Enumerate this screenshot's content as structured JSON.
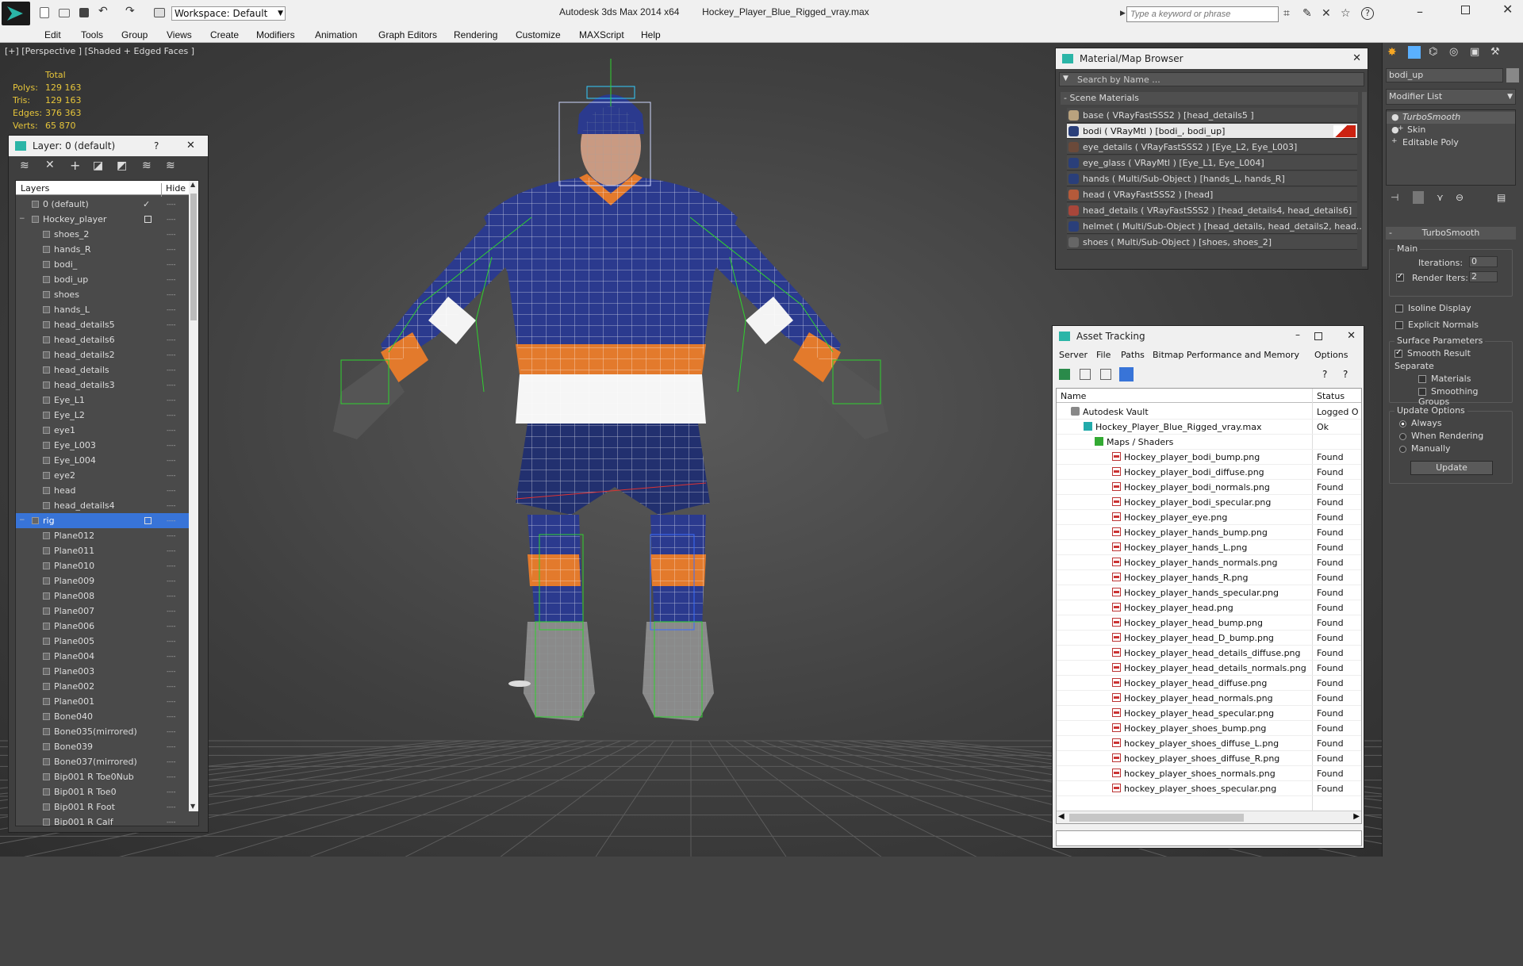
{
  "titlebar": {
    "app": "Autodesk 3ds Max  2014 x64",
    "file": "Hockey_Player_Blue_Rigged_vray.max",
    "workspace": "Workspace: Default",
    "search_placeholder": "Type a keyword or phrase"
  },
  "menu": [
    "Edit",
    "Tools",
    "Group",
    "Views",
    "Create",
    "Modifiers",
    "Animation",
    "Graph Editors",
    "Rendering",
    "Customize",
    "MAXScript",
    "Help"
  ],
  "viewport": {
    "label": "[+] [Perspective ] [Shaded + Edged Faces ]",
    "stats": {
      "header": "Total",
      "rows": [
        {
          "k": "Polys:",
          "v": "129 163"
        },
        {
          "k": "Tris:",
          "v": "129 163"
        },
        {
          "k": "Edges:",
          "v": "376 363"
        },
        {
          "k": "Verts:",
          "v": "65 870"
        }
      ]
    }
  },
  "layer_panel": {
    "title": "Layer: 0 (default)",
    "help": "?",
    "col_layers": "Layers",
    "col_hide": "Hide",
    "items": [
      {
        "label": "0 (default)",
        "indent": 1
      },
      {
        "label": "Hockey_player",
        "indent": 1
      },
      {
        "label": "shoes_2",
        "indent": 2
      },
      {
        "label": "hands_R",
        "indent": 2
      },
      {
        "label": "bodi_",
        "indent": 2
      },
      {
        "label": "bodi_up",
        "indent": 2
      },
      {
        "label": "shoes",
        "indent": 2
      },
      {
        "label": "hands_L",
        "indent": 2
      },
      {
        "label": "head_details5",
        "indent": 2
      },
      {
        "label": "head_details6",
        "indent": 2
      },
      {
        "label": "head_details2",
        "indent": 2
      },
      {
        "label": "head_details",
        "indent": 2
      },
      {
        "label": "head_details3",
        "indent": 2
      },
      {
        "label": "Eye_L1",
        "indent": 2
      },
      {
        "label": "Eye_L2",
        "indent": 2
      },
      {
        "label": "eye1",
        "indent": 2
      },
      {
        "label": "Eye_L003",
        "indent": 2
      },
      {
        "label": "Eye_L004",
        "indent": 2
      },
      {
        "label": "eye2",
        "indent": 2
      },
      {
        "label": "head",
        "indent": 2
      },
      {
        "label": "head_details4",
        "indent": 2
      },
      {
        "label": "rig",
        "indent": 1,
        "selected": true
      },
      {
        "label": "Plane012",
        "indent": 2
      },
      {
        "label": "Plane011",
        "indent": 2
      },
      {
        "label": "Plane010",
        "indent": 2
      },
      {
        "label": "Plane009",
        "indent": 2
      },
      {
        "label": "Plane008",
        "indent": 2
      },
      {
        "label": "Plane007",
        "indent": 2
      },
      {
        "label": "Plane006",
        "indent": 2
      },
      {
        "label": "Plane005",
        "indent": 2
      },
      {
        "label": "Plane004",
        "indent": 2
      },
      {
        "label": "Plane003",
        "indent": 2
      },
      {
        "label": "Plane002",
        "indent": 2
      },
      {
        "label": "Plane001",
        "indent": 2
      },
      {
        "label": "Bone040",
        "indent": 2
      },
      {
        "label": "Bone035(mirrored)",
        "indent": 2
      },
      {
        "label": "Bone039",
        "indent": 2
      },
      {
        "label": "Bone037(mirrored)",
        "indent": 2
      },
      {
        "label": "Bip001 R Toe0Nub",
        "indent": 2
      },
      {
        "label": "Bip001 R Toe0",
        "indent": 2
      },
      {
        "label": "Bip001 R Foot",
        "indent": 2
      },
      {
        "label": "Bip001 R Calf",
        "indent": 2
      }
    ]
  },
  "material_browser": {
    "title": "Material/Map Browser",
    "search_placeholder": "Search by Name ...",
    "section": "- Scene Materials",
    "items": [
      "base  ( VRayFastSSS2 )  [head_details5 ]",
      "bodi  ( VRayMtl ) [bodi_, bodi_up]",
      "eye_details  ( VRayFastSSS2 )  [Eye_L2, Eye_L003]",
      "eye_glass  ( VRayMtl )  [Eye_L1, Eye_L004]",
      "hands  ( Multi/Sub-Object )  [hands_L, hands_R]",
      "head  ( VRayFastSSS2 )  [head]",
      "head_details  ( VRayFastSSS2 )  [head_details4, head_details6]",
      "helmet  ( Multi/Sub-Object )  [head_details, head_details2, head...",
      "shoes  ( Multi/Sub-Object )  [shoes, shoes_2]"
    ],
    "swatches": [
      "#b9a27e",
      "#2a3f7a",
      "#6b4a3a",
      "#2a3f7a",
      "#2a3f7a",
      "#b45a3a",
      "#a8463a",
      "#2a3f7a",
      "#666666"
    ]
  },
  "asset_tracking": {
    "title": "Asset Tracking",
    "menu": [
      "Server",
      "File",
      "Paths",
      "Bitmap Performance and Memory",
      "Options"
    ],
    "col_name": "Name",
    "col_status": "Status",
    "rows": [
      {
        "name": "Autodesk Vault",
        "status": "Logged O",
        "level": 1,
        "icon": "vault"
      },
      {
        "name": "Hockey_Player_Blue_Rigged_vray.max",
        "status": "Ok",
        "level": 2,
        "icon": "max"
      },
      {
        "name": "Maps / Shaders",
        "status": "",
        "level": 3,
        "icon": "maps"
      },
      {
        "name": "Hockey_player_bodi_bump.png",
        "status": "Found",
        "level": 4,
        "icon": "png"
      },
      {
        "name": "Hockey_player_bodi_diffuse.png",
        "status": "Found",
        "level": 4,
        "icon": "png"
      },
      {
        "name": "Hockey_player_bodi_normals.png",
        "status": "Found",
        "level": 4,
        "icon": "png"
      },
      {
        "name": "Hockey_player_bodi_specular.png",
        "status": "Found",
        "level": 4,
        "icon": "png"
      },
      {
        "name": "Hockey_player_eye.png",
        "status": "Found",
        "level": 4,
        "icon": "png"
      },
      {
        "name": "Hockey_player_hands_bump.png",
        "status": "Found",
        "level": 4,
        "icon": "png"
      },
      {
        "name": "Hockey_player_hands_L.png",
        "status": "Found",
        "level": 4,
        "icon": "png"
      },
      {
        "name": "Hockey_player_hands_normals.png",
        "status": "Found",
        "level": 4,
        "icon": "png"
      },
      {
        "name": "Hockey_player_hands_R.png",
        "status": "Found",
        "level": 4,
        "icon": "png"
      },
      {
        "name": "Hockey_player_hands_specular.png",
        "status": "Found",
        "level": 4,
        "icon": "png"
      },
      {
        "name": "Hockey_player_head.png",
        "status": "Found",
        "level": 4,
        "icon": "png"
      },
      {
        "name": "Hockey_player_head_bump.png",
        "status": "Found",
        "level": 4,
        "icon": "png"
      },
      {
        "name": "Hockey_player_head_D_bump.png",
        "status": "Found",
        "level": 4,
        "icon": "png"
      },
      {
        "name": "Hockey_player_head_details_diffuse.png",
        "status": "Found",
        "level": 4,
        "icon": "png"
      },
      {
        "name": "Hockey_player_head_details_normals.png",
        "status": "Found",
        "level": 4,
        "icon": "png"
      },
      {
        "name": "Hockey_player_head_diffuse.png",
        "status": "Found",
        "level": 4,
        "icon": "png"
      },
      {
        "name": "Hockey_player_head_normals.png",
        "status": "Found",
        "level": 4,
        "icon": "png"
      },
      {
        "name": "Hockey_player_head_specular.png",
        "status": "Found",
        "level": 4,
        "icon": "png"
      },
      {
        "name": "Hockey_player_shoes_bump.png",
        "status": "Found",
        "level": 4,
        "icon": "png"
      },
      {
        "name": "hockey_player_shoes_diffuse_L.png",
        "status": "Found",
        "level": 4,
        "icon": "png"
      },
      {
        "name": "hockey_player_shoes_diffuse_R.png",
        "status": "Found",
        "level": 4,
        "icon": "png"
      },
      {
        "name": "hockey_player_shoes_normals.png",
        "status": "Found",
        "level": 4,
        "icon": "png"
      },
      {
        "name": "hockey_player_shoes_specular.png",
        "status": "Found",
        "level": 4,
        "icon": "png"
      }
    ]
  },
  "command_panel": {
    "object_name": "bodi_up",
    "modifier_list": "Modifier List",
    "stack": [
      "TurboSmooth",
      "Skin",
      "Editable Poly"
    ],
    "rollout": "TurboSmooth",
    "main": "Main",
    "iterations_label": "Iterations:",
    "iterations": "0",
    "render_iters_label": "Render Iters:",
    "render_iters": "2",
    "isoline": "Isoline Display",
    "explicit_normals": "Explicit Normals",
    "surface_params": "Surface Parameters",
    "smooth_result": "Smooth Result",
    "separate": "Separate",
    "materials": "Materials",
    "smoothing_groups": "Smoothing Groups",
    "update_options": "Update Options",
    "always": "Always",
    "when_rendering": "When Rendering",
    "manually": "Manually",
    "update_btn": "Update"
  }
}
